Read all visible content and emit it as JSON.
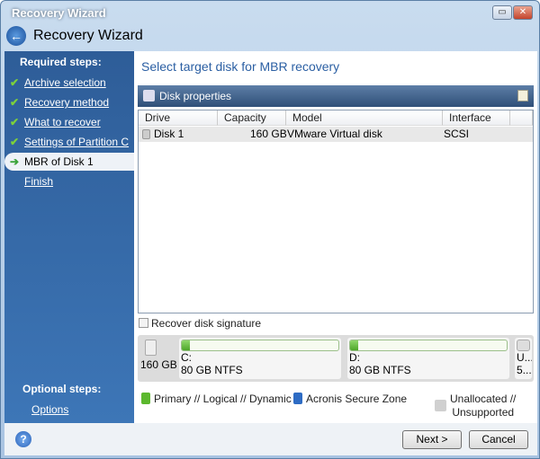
{
  "window": {
    "title": "Recovery Wizard",
    "header": "Recovery Wizard"
  },
  "sidebar": {
    "required_label": "Required steps:",
    "steps": [
      {
        "label": "Archive selection",
        "state": "done"
      },
      {
        "label": "Recovery method",
        "state": "done"
      },
      {
        "label": "What to recover",
        "state": "done"
      },
      {
        "label": "Settings of Partition C",
        "state": "done"
      },
      {
        "label": "MBR of Disk 1",
        "state": "current"
      },
      {
        "label": "Finish",
        "state": "pending"
      }
    ],
    "optional_label": "Optional steps:",
    "options": "Options"
  },
  "main": {
    "title": "Select target disk for MBR recovery",
    "toolbar_label": "Disk properties",
    "columns": [
      "Drive",
      "Capacity",
      "Model",
      "Interface"
    ],
    "rows": [
      {
        "drive": "Disk 1",
        "capacity": "160 GB",
        "model": "VMware Virtual disk",
        "interface": "SCSI"
      }
    ],
    "recover_signature": {
      "label": "Recover disk signature",
      "checked": false
    },
    "disk_map": {
      "size": "160 GB",
      "partitions": [
        {
          "letter": "C:",
          "info": "80 GB  NTFS",
          "used_fraction": 0.05
        },
        {
          "letter": "D:",
          "info": "80 GB  NTFS",
          "used_fraction": 0.05
        },
        {
          "letter": "U...",
          "info": "5..."
        }
      ]
    },
    "legend": {
      "primary": "Primary // Logical // Dynamic",
      "asz": "Acronis Secure Zone",
      "unalloc1": "Unallocated //",
      "unalloc2": "Unsupported"
    },
    "colors": {
      "primary": "#5cb82e",
      "asz": "#2e6cc4",
      "unallocated": "#d0d0d0"
    }
  },
  "footer": {
    "next": "Next >",
    "cancel": "Cancel"
  }
}
